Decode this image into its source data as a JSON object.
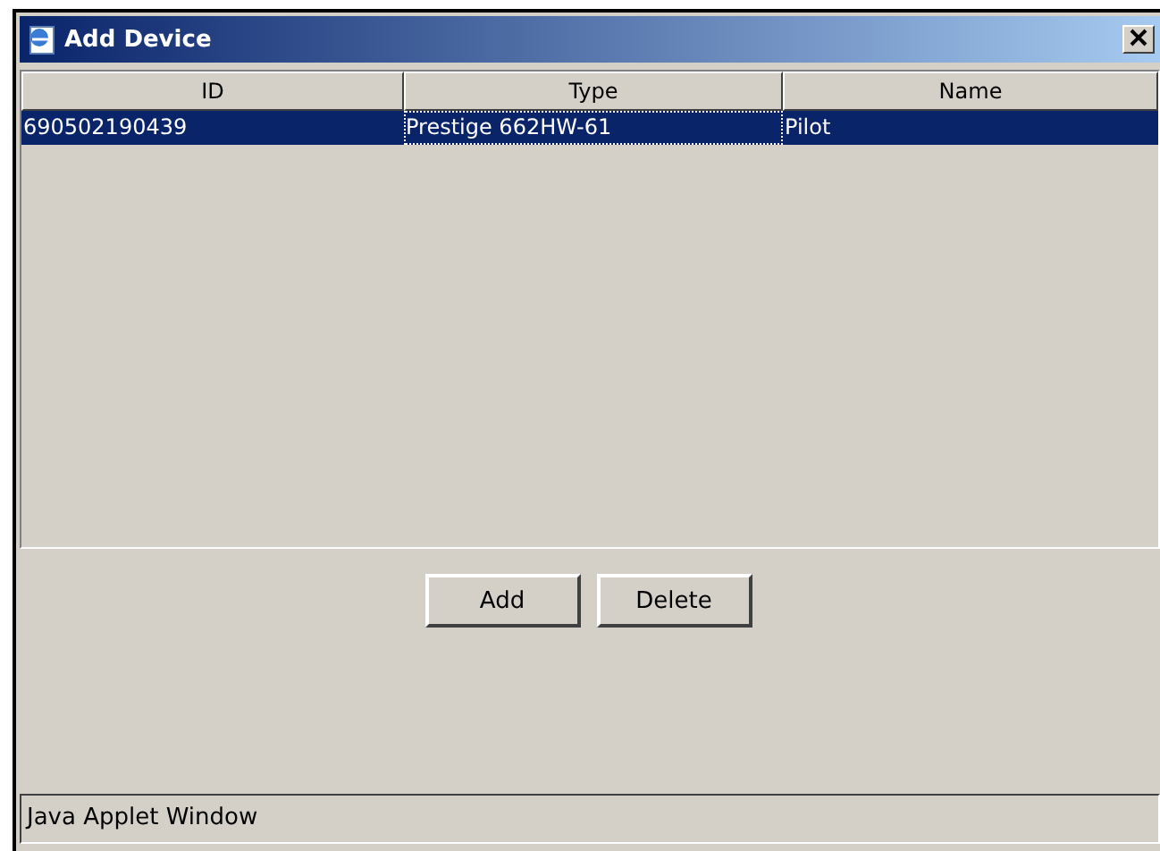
{
  "window": {
    "title": "Add Device"
  },
  "table": {
    "columns": [
      "ID",
      "Type",
      "Name"
    ],
    "rows": [
      {
        "cells": [
          "690502190439",
          "Prestige 662HW-61",
          "Pilot"
        ],
        "selected": true
      }
    ]
  },
  "buttons": [
    "Add",
    "Delete"
  ],
  "status_bar": "Java Applet Window"
}
